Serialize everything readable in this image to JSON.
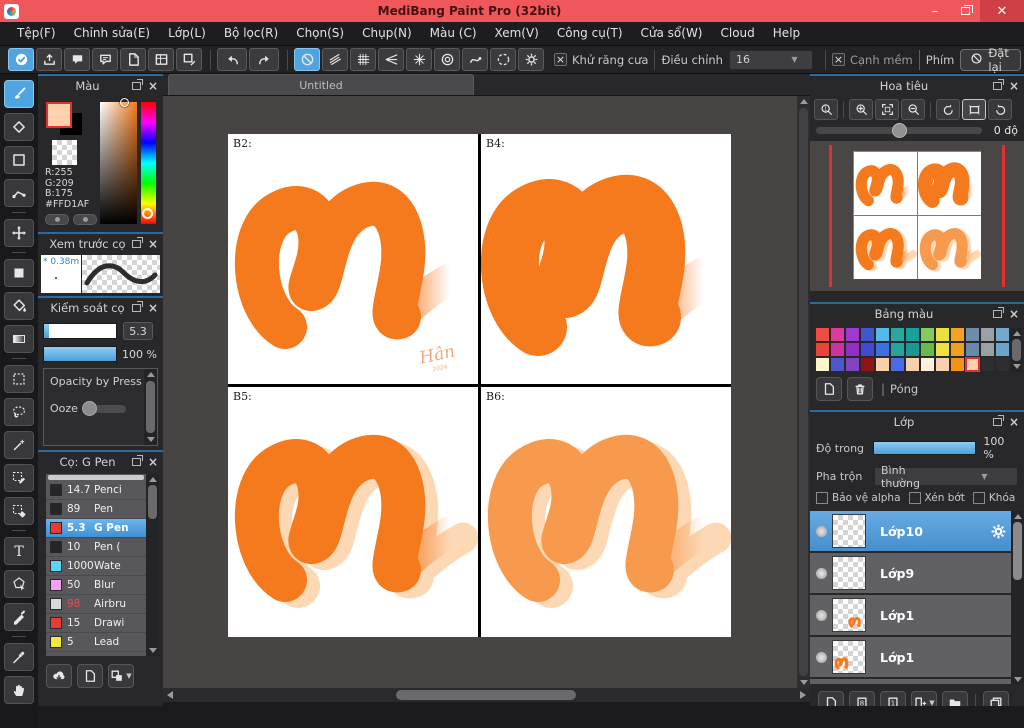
{
  "window": {
    "title": "MediBang Paint Pro (32bit)"
  },
  "menu": {
    "items": [
      "Tệp(F)",
      "Chỉnh sửa(E)",
      "Lớp(L)",
      "Bộ lọc(R)",
      "Chọn(S)",
      "Chụp(N)",
      "Màu (C)",
      "Xem(V)",
      "Công cụ(T)",
      "Cửa sổ(W)",
      "Cloud",
      "Help"
    ]
  },
  "toolbar": {
    "left_icons": [
      {
        "name": "main-check",
        "selected": true
      },
      {
        "name": "upload"
      },
      {
        "name": "comment"
      },
      {
        "name": "chat"
      },
      {
        "name": "document"
      },
      {
        "name": "panel-layout"
      },
      {
        "name": "material"
      }
    ],
    "history_icons": [
      {
        "name": "undo"
      },
      {
        "name": "redo"
      }
    ],
    "snap_icons": [
      {
        "name": "snap-off",
        "selected": true
      },
      {
        "name": "snap-parallel"
      },
      {
        "name": "snap-grid"
      },
      {
        "name": "snap-vanishing"
      },
      {
        "name": "snap-radial"
      },
      {
        "name": "snap-concentric"
      },
      {
        "name": "snap-curve"
      },
      {
        "name": "snap-ellipse"
      },
      {
        "name": "snap-settings"
      }
    ],
    "antialias_label": "Khử răng cưa",
    "adjust_label": "Điều chỉnh",
    "adjust_value": "16",
    "soft_edge_label": "Cạnh mềm",
    "key_label": "Phím",
    "reset_label": "Đặt lại"
  },
  "tools": [
    {
      "name": "brush",
      "selected": true
    },
    {
      "name": "eraser"
    },
    {
      "name": "shape-rect"
    },
    {
      "name": "curve"
    },
    {
      "name": "move"
    },
    {
      "name": "shape-fill"
    },
    {
      "name": "bucket"
    },
    {
      "name": "gradient"
    },
    {
      "name": "select-rect"
    },
    {
      "name": "lasso"
    },
    {
      "name": "magic-wand"
    },
    {
      "name": "select-pen"
    },
    {
      "name": "select-eraser"
    },
    {
      "name": "text"
    },
    {
      "name": "object-select"
    },
    {
      "name": "pen"
    },
    {
      "name": "eyedropper"
    },
    {
      "name": "hand"
    }
  ],
  "color_panel": {
    "title": "Màu",
    "r_label": "R:255",
    "g_label": "G:209",
    "b_label": "B:175",
    "hex_label": "#FFD1AF",
    "foreground_color": "#FFD1AF",
    "secondary_color": "#000000"
  },
  "brush_preview": {
    "title": "Xem trước cọ",
    "size_label": "* 0.38m"
  },
  "brush_control": {
    "title": "Kiểm soát cọ",
    "size_value": "5.3",
    "opacity_value": "100 %",
    "rows": [
      "Opacity by Press",
      "Ooze"
    ]
  },
  "brush_panel": {
    "title": "Cọ: G Pen",
    "brushes": [
      {
        "swatch": "#262626",
        "size": "14.7",
        "name": "Penci",
        "size_red": false,
        "selected": false
      },
      {
        "swatch": "#262626",
        "size": "89",
        "name": "Pen",
        "size_red": false,
        "selected": false
      },
      {
        "swatch": "#e63c34",
        "size": "5.3",
        "name": "G Pen",
        "size_red": true,
        "selected": true
      },
      {
        "swatch": "#262626",
        "size": "10",
        "name": "Pen (",
        "size_red": false,
        "selected": false
      },
      {
        "swatch": "#59d7f2",
        "size": "1000",
        "name": "Wate",
        "size_red": false,
        "selected": false
      },
      {
        "swatch": "#f2a0ef",
        "size": "50",
        "name": "Blur",
        "size_red": false,
        "selected": false
      },
      {
        "swatch": "#d9d9d9",
        "size": "98",
        "name": "Airbru",
        "size_red": true,
        "selected": false
      },
      {
        "swatch": "#e63c34",
        "size": "15",
        "name": "Drawi",
        "size_red": false,
        "selected": false
      },
      {
        "swatch": "#f2ea3a",
        "size": "5",
        "name": "Lead",
        "size_red": false,
        "selected": false
      }
    ],
    "footer_icons": [
      {
        "name": "cloud-download"
      },
      {
        "name": "new-brush"
      },
      {
        "name": "brush-from-image"
      }
    ]
  },
  "canvas": {
    "tab": "Untitled",
    "quadrants": [
      {
        "label": "B2:",
        "variant": "solid"
      },
      {
        "label": "B4:",
        "variant": "blob"
      },
      {
        "label": "B5:",
        "variant": "shadow"
      },
      {
        "label": "B6:",
        "variant": "shadow-light"
      }
    ],
    "signature": "Hân",
    "signature_sub": "2024"
  },
  "navigator": {
    "title": "Hoa tiêu",
    "icons": [
      {
        "name": "zoom-actual"
      },
      {
        "name": "zoom-in"
      },
      {
        "name": "zoom-fit"
      },
      {
        "name": "zoom-out"
      },
      {
        "name": "rotate-left"
      },
      {
        "name": "rotate-reset",
        "selected": true
      },
      {
        "name": "rotate-right"
      }
    ],
    "angle_value": "0 độ"
  },
  "palette": {
    "title": "Bảng màu",
    "footer_label": "Póng",
    "footer_icons": [
      {
        "name": "add-color"
      },
      {
        "name": "delete-color"
      }
    ],
    "rows": [
      [
        "#ef4c44",
        "#df3a9e",
        "#a138ce",
        "#4156c8",
        "#54b9ea",
        "#2aa8a0",
        "#16a298",
        "#84ca5e",
        "#e9e23e",
        "#f2a325",
        "#6e8ca9",
        "#9aa0a3",
        "#74a9cc"
      ],
      [
        "#ea4438",
        "#cf30a2",
        "#9030c2",
        "#4449d2",
        "#3b70e2",
        "#24a49a",
        "#1a9890",
        "#66ba4c",
        "#ede042",
        "#f0a021",
        "#6a88a7",
        "#99a1a3",
        "#6ca5c9"
      ],
      [
        "#fbf6ca",
        "#4a5ace",
        "#8342c2",
        "#8d1518",
        "#f9d0ae",
        "#4b6be6",
        "#f9d0ae",
        "#fbf1dd",
        "#f9d0ae",
        "#f29219",
        "#ffd1af",
        null,
        null
      ]
    ],
    "selected": {
      "row": 2,
      "col": 10
    }
  },
  "layers": {
    "title": "Lớp",
    "opacity_label": "Độ trong",
    "opacity_value": "100 %",
    "blend_label": "Pha trộn",
    "blend_value": "Bình thường",
    "checkbox_labels": [
      "Bảo vệ alpha",
      "Xén bớt",
      "Khóa"
    ],
    "items": [
      {
        "name": "Lớp10",
        "selected": true,
        "thumb": "empty"
      },
      {
        "name": "Lớp9",
        "selected": false,
        "thumb": "empty"
      },
      {
        "name": "Lớp1",
        "selected": false,
        "thumb": "mark-right"
      },
      {
        "name": "Lớp1",
        "selected": false,
        "thumb": "mark-left"
      }
    ],
    "footer_icons": [
      {
        "name": "new-layer"
      },
      {
        "name": "new-8bit-layer"
      },
      {
        "name": "new-1bit-layer"
      },
      {
        "name": "add-layer-menu"
      },
      {
        "name": "new-folder"
      },
      {
        "name": "duplicate-layer"
      }
    ]
  },
  "colors": {
    "accent_blue": "#4fa5e2",
    "stroke_orange": "#f5791d",
    "stroke_orange_light": "#f89a4d",
    "shadow_peach": "#fcd8b5",
    "titlebar_red": "#f0575b"
  }
}
